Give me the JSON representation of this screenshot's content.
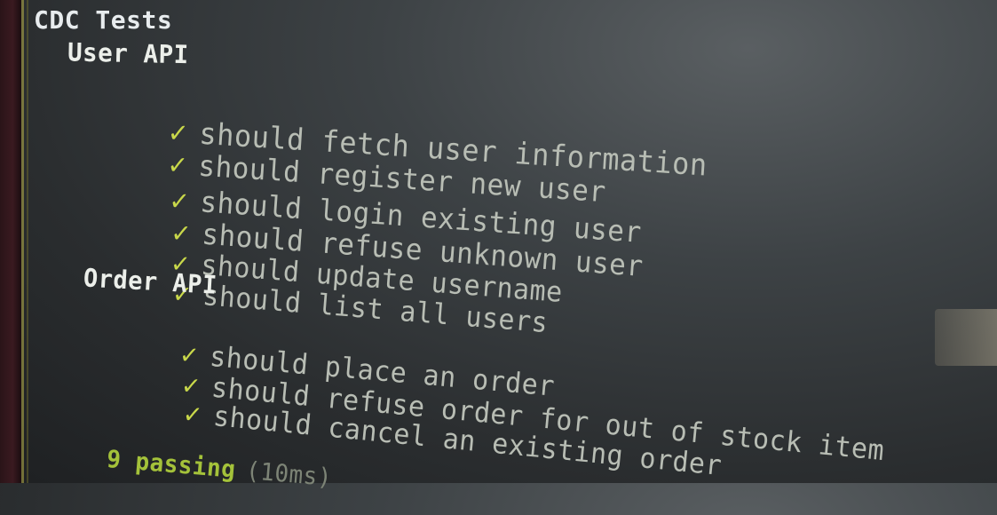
{
  "terminal": {
    "suite_title": "CDC Tests",
    "groups": [
      {
        "name": "User API",
        "check_glyph": "✓",
        "tests": [
          "should fetch user information",
          "should register new user",
          "should login existing user",
          "should refuse unknown user",
          "should update username",
          "should list all users"
        ]
      },
      {
        "name": "Order API",
        "check_glyph": "✓",
        "tests": [
          "should place an order",
          "should refuse order for out of stock item",
          "should cancel an existing order"
        ]
      }
    ],
    "summary": {
      "passing": "9 passing",
      "duration": "(10ms)"
    },
    "colors": {
      "check": "#c9d84a",
      "passing": "#a4c23a",
      "test_text": "#b8bdb4",
      "heading_text": "#e8ecee"
    }
  }
}
